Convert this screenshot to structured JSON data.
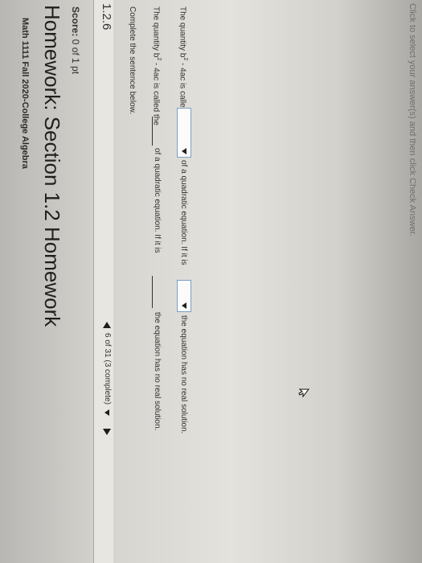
{
  "header": {
    "course": "Math 1111 Fall 2020-College Algebra",
    "title": "Homework: Section 1.2 Homework",
    "score_label": "Score:",
    "score_value": "0 of 1 pt"
  },
  "question": {
    "number": "1.2.6",
    "progress": "6 of 31 (3 complete)",
    "instructions": "Complete the sentence below.",
    "sentence1": {
      "part_a": "The quantity b",
      "exponent": "2",
      "part_b": " - 4ac is called the",
      "part_c": "of a quadratic equation. If it is",
      "part_d": "the equation has no real solution."
    },
    "sentence2": {
      "part_a": "The quantity b",
      "exponent": "2",
      "part_b": " - 4ac is called the",
      "part_c": "of a quadratic equation. If it is",
      "part_d": "the equation has no real solution."
    }
  },
  "footer": {
    "hint": "Click to select your answer(s) and then click Check Answer."
  },
  "icons": {
    "prev": "triangle-left-icon",
    "next": "triangle-right-icon",
    "dropdown": "triangle-down-icon",
    "cursor": "mouse-pointer-icon"
  },
  "colors": {
    "dropdown_border": "#7a9ec5",
    "text": "#333333"
  }
}
